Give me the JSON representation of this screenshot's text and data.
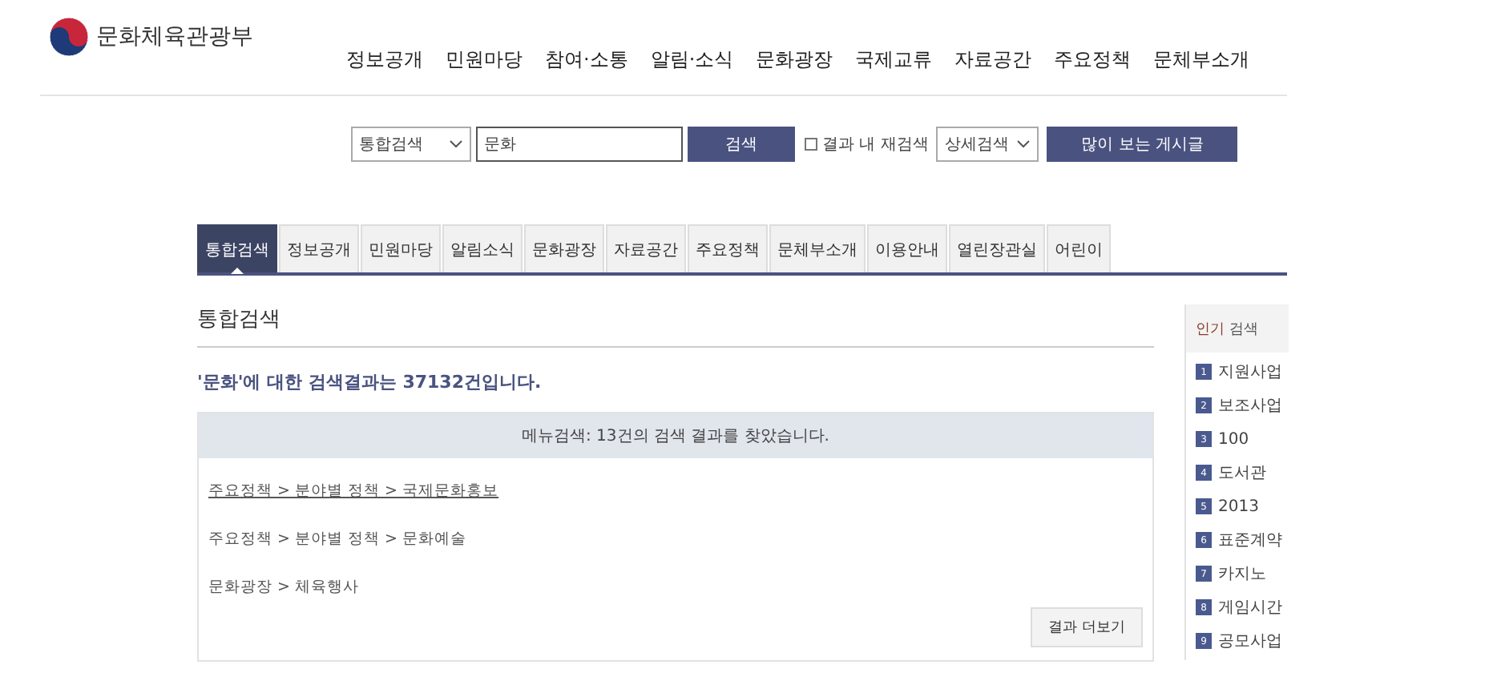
{
  "header": {
    "logo_text": "문화체육관광부",
    "nav": [
      "정보공개",
      "민원마당",
      "참여·소통",
      "알림·소식",
      "문화광장",
      "국제교류",
      "자료공간",
      "주요정책",
      "문체부소개"
    ]
  },
  "search": {
    "scope": "통합검색",
    "query": "문화",
    "search_button": "검색",
    "refine_checked": false,
    "refine_label": "결과 내 재검색",
    "detail_select": "상세검색",
    "popular_button": "많이 보는 게시글"
  },
  "tabs": [
    {
      "label": "통합검색",
      "selected": true
    },
    {
      "label": "정보공개",
      "selected": false
    },
    {
      "label": "민원마당",
      "selected": false
    },
    {
      "label": "알림소식",
      "selected": false
    },
    {
      "label": "문화광장",
      "selected": false
    },
    {
      "label": "자료공간",
      "selected": false
    },
    {
      "label": "주요정책",
      "selected": false
    },
    {
      "label": "문체부소개",
      "selected": false
    },
    {
      "label": "이용안내",
      "selected": false
    },
    {
      "label": "열린장관실",
      "selected": false
    },
    {
      "label": "어린이",
      "selected": false
    }
  ],
  "section_title": "통합검색",
  "result_summary": "'문화'에 대한 검색결과는 37132건입니다.",
  "menu_results": {
    "header": "메뉴검색: 13건의 검색 결과를 찾았습니다.",
    "links": [
      {
        "text": "주요정책 > 분야별 정책 > 국제문화홍보",
        "underlined": true
      },
      {
        "text": "주요정책 > 분야별 정책 > 문화예술",
        "underlined": false
      },
      {
        "text": "문화광장 > 체육행사",
        "underlined": false
      }
    ],
    "more_button": "결과 더보기"
  },
  "popular": {
    "title_highlight": "인기",
    "title_rest": "검색",
    "items": [
      {
        "rank": "1",
        "term": "지원사업"
      },
      {
        "rank": "2",
        "term": "보조사업"
      },
      {
        "rank": "3",
        "term": "100"
      },
      {
        "rank": "4",
        "term": "도서관"
      },
      {
        "rank": "5",
        "term": "2013"
      },
      {
        "rank": "6",
        "term": "표준계약"
      },
      {
        "rank": "7",
        "term": "카지노"
      },
      {
        "rank": "8",
        "term": "게임시간"
      },
      {
        "rank": "9",
        "term": "공모사업"
      }
    ]
  }
}
